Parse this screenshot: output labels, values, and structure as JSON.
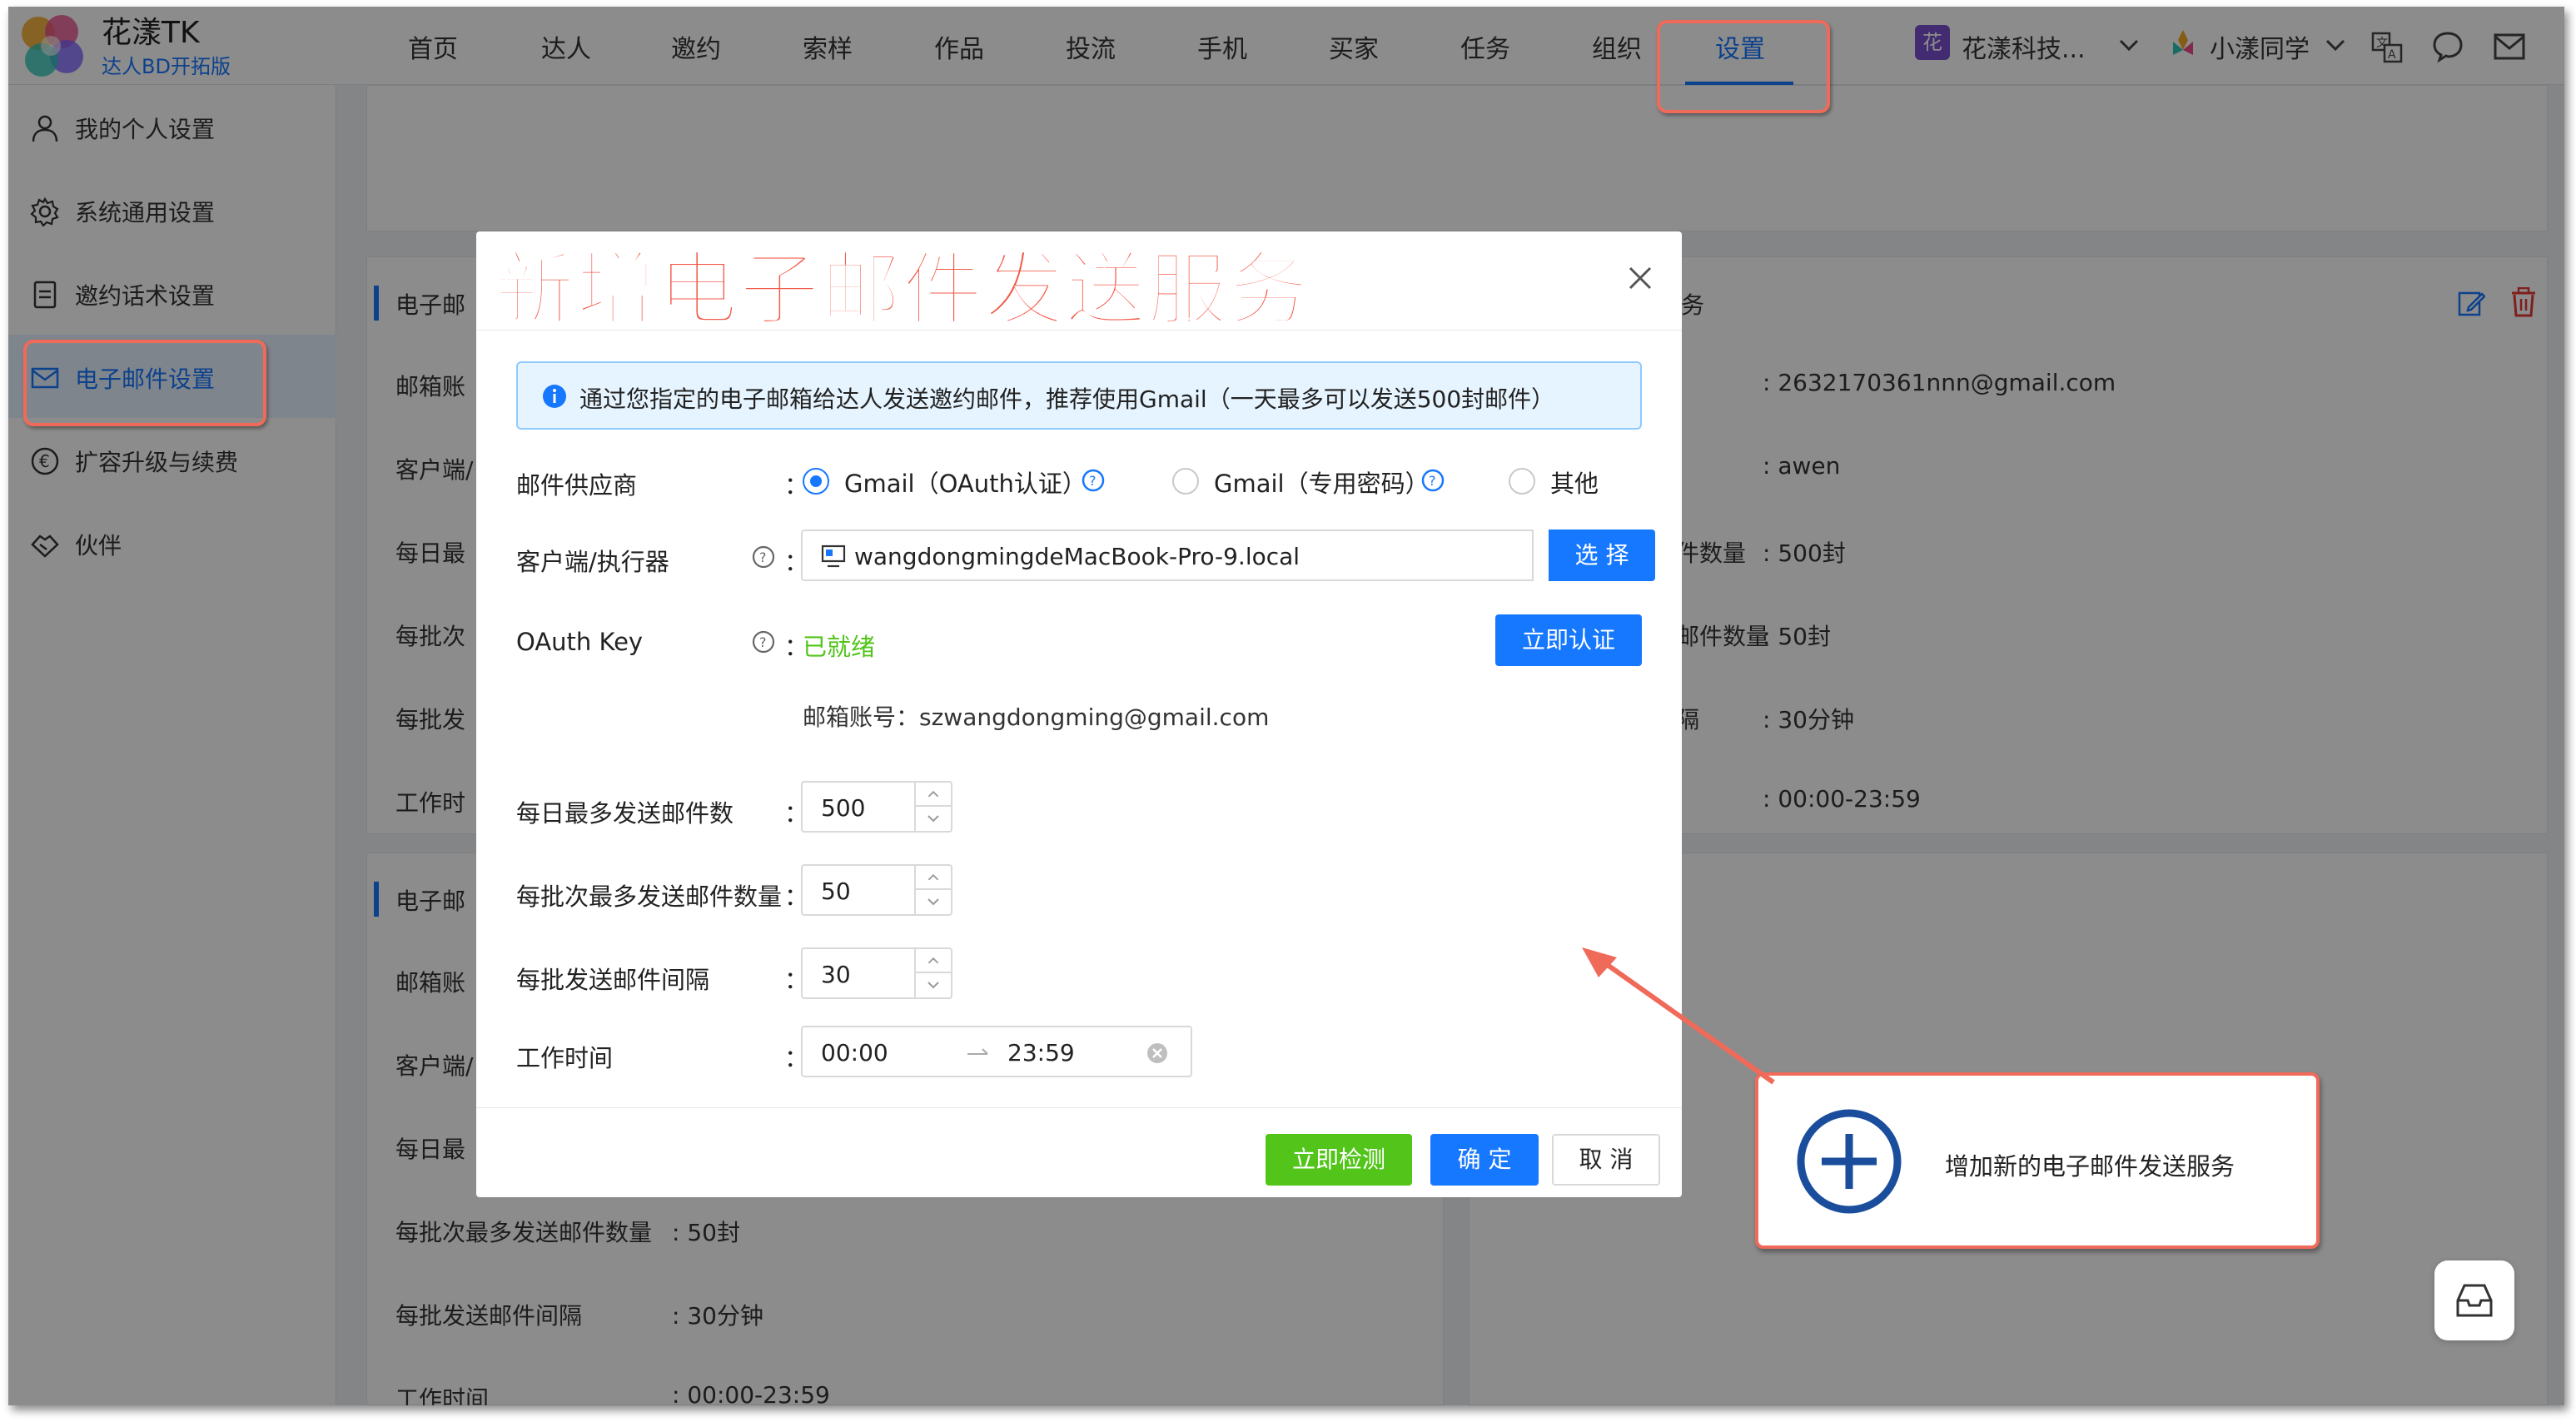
{
  "brand": {
    "name": "花漾TK",
    "subtitle": "达人BD开拓版"
  },
  "nav": {
    "items": [
      {
        "label": "首页"
      },
      {
        "label": "达人"
      },
      {
        "label": "邀约"
      },
      {
        "label": "索样"
      },
      {
        "label": "作品"
      },
      {
        "label": "投流"
      },
      {
        "label": "手机"
      },
      {
        "label": "买家"
      },
      {
        "label": "任务"
      },
      {
        "label": "组织"
      },
      {
        "label": "设置"
      }
    ],
    "active": "设置"
  },
  "header_right": {
    "team_badge": "花",
    "team_name": "花漾科技...",
    "user_name": "小漾同学"
  },
  "sidebar": {
    "items": [
      {
        "label": "我的个人设置",
        "icon": "user-icon"
      },
      {
        "label": "系统通用设置",
        "icon": "gear-icon"
      },
      {
        "label": "邀约话术设置",
        "icon": "document-icon"
      },
      {
        "label": "电子邮件设置",
        "icon": "mail-icon"
      },
      {
        "label": "扩容升级与续费",
        "icon": "dollar-circle-icon"
      },
      {
        "label": "伙伴",
        "icon": "handshake-icon"
      }
    ],
    "active": "电子邮件设置"
  },
  "background_cards": {
    "card1": {
      "title": "电子邮",
      "title_right": "务",
      "labels": [
        "邮箱账",
        "客户端/",
        "每日最",
        "每批次",
        "每批发",
        "工作时"
      ],
      "values": [
        ": 2632170361nnn@gmail.com",
        ": awen",
        ": 500封",
        ": 50封",
        ": 30分钟",
        ": 00:00-23:59"
      ],
      "right_labels": [
        "件数量",
        "邮件数量",
        "隔"
      ]
    },
    "card2": {
      "title": "电子邮",
      "labels": [
        "邮箱账",
        "客户端/",
        "每日最"
      ],
      "rows": [
        {
          "label": "每批次最多发送邮件数量",
          "value": ": 50封"
        },
        {
          "label": "每批发送邮件间隔",
          "value": ": 30分钟"
        },
        {
          "label": "工作时间",
          "value": ": 00:00-23:59"
        }
      ]
    }
  },
  "modal": {
    "title": "新增电子邮件发送服务",
    "info": "通过您指定的电子邮箱给达人发送邀约邮件，推荐使用Gmail（一天最多可以发送500封邮件）",
    "provider": {
      "label": "邮件供应商",
      "options": [
        "Gmail（OAuth认证）",
        "Gmail（专用密码）",
        "其他"
      ],
      "selected": "Gmail（OAuth认证）"
    },
    "executor": {
      "label": "客户端/执行器",
      "value": "wangdongmingdeMacBook-Pro-9.local",
      "button": "选 择"
    },
    "oauth": {
      "label": "OAuth Key",
      "status": "已就绪",
      "button": "立即认证",
      "account_label": "邮箱账号：",
      "account": "szwangdongming@gmail.com"
    },
    "daily_max": {
      "label": "每日最多发送邮件数",
      "value": "500"
    },
    "batch_max": {
      "label": "每批次最多发送邮件数量",
      "value": "50"
    },
    "batch_interval": {
      "label": "每批发送邮件间隔",
      "value": "30"
    },
    "work_time": {
      "label": "工作时间",
      "start": "00:00",
      "end": "23:59"
    },
    "colon": "：",
    "buttons": {
      "check": "立即检测",
      "ok": "确 定",
      "cancel": "取 消"
    }
  },
  "add_service": {
    "label": "增加新的电子邮件发送服务"
  },
  "colors": {
    "primary": "#1677ff",
    "success": "#52c41a",
    "annotation_red": "#f06a5a",
    "title_red": "#f35a4a",
    "danger": "#e53935"
  }
}
